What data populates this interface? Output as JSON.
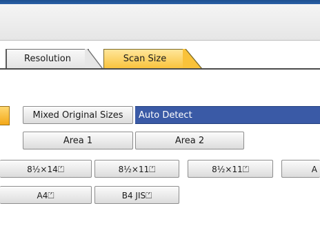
{
  "tabs": [
    {
      "label": "Resolution",
      "selected": false
    },
    {
      "label": "Scan Size",
      "selected": true
    }
  ],
  "mixed_sizes_button": "Mixed Original Sizes",
  "auto_detect_field": "Auto Detect",
  "area_buttons": [
    "Area 1",
    "Area 2"
  ],
  "size_row_1": [
    "8½×14⏍",
    "8½×11⏍",
    "8½×11⏍",
    "A"
  ],
  "size_row_2": [
    "A4⏍",
    "B4 JIS⏍"
  ],
  "colors": {
    "top_bar": "#1d4f8f",
    "selected_tab": "#f9c23a",
    "auto_detect_field": "#3a5aa6"
  }
}
